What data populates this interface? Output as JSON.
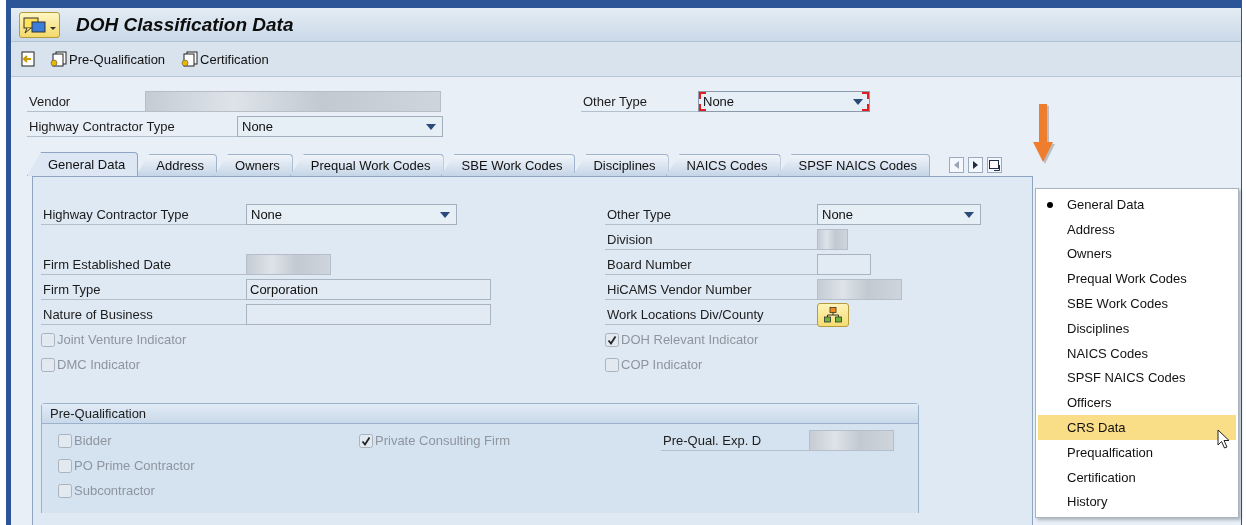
{
  "window": {
    "title": "DOH Classification Data"
  },
  "toolbar": {
    "buttons": [
      {
        "label": "Pre-Qualification"
      },
      {
        "label": "Certification"
      }
    ]
  },
  "header": {
    "left": [
      {
        "kind": "masked",
        "label": "Vendor"
      },
      {
        "kind": "dropdown",
        "label": "Highway Contractor Type",
        "value": "None"
      }
    ],
    "right": [
      {
        "kind": "dropdown",
        "label": "Other Type",
        "value": "None",
        "focused": true
      }
    ]
  },
  "tabs": [
    {
      "label": "General Data",
      "selected": true
    },
    {
      "label": "Address",
      "selected": false
    },
    {
      "label": "Owners",
      "selected": false
    },
    {
      "label": "Prequal Work Codes",
      "selected": false
    },
    {
      "label": "SBE Work Codes",
      "selected": false
    },
    {
      "label": "Disciplines",
      "selected": false
    },
    {
      "label": "NAICS Codes",
      "selected": false
    },
    {
      "label": "SPSF NAICS Codes",
      "selected": false
    }
  ],
  "general_data": {
    "left": [
      {
        "kind": "dropdown",
        "label": "Highway Contractor Type",
        "value": "None"
      },
      {
        "kind": "masked",
        "label": "Firm Established Date"
      },
      {
        "kind": "input",
        "label": "Firm Type",
        "value": "Corporation"
      },
      {
        "kind": "input",
        "label": "Nature of Business"
      },
      {
        "kind": "checkbox",
        "label": "Joint Venture Indicator",
        "checked": false,
        "disabled": true
      },
      {
        "kind": "checkbox",
        "label": "DMC Indicator",
        "checked": false,
        "disabled": true
      }
    ],
    "right": [
      {
        "kind": "dropdown",
        "label": "Other Type",
        "value": "None"
      },
      {
        "kind": "masked",
        "label": "Division"
      },
      {
        "kind": "input",
        "label": "Board Number"
      },
      {
        "kind": "masked",
        "label": "HiCAMS Vendor Number"
      },
      {
        "kind": "button",
        "label": "Work Locations Div/County"
      },
      {
        "kind": "checkbox",
        "label": "DOH Relevant Indicator",
        "checked": true,
        "disabled": true
      },
      {
        "kind": "checkbox",
        "label": "COP Indicator",
        "checked": false,
        "disabled": true
      }
    ]
  },
  "prequalification": {
    "title": "Pre-Qualification",
    "columns": [
      [
        {
          "kind": "checkbox",
          "label": "Bidder",
          "checked": false,
          "disabled": true
        },
        {
          "kind": "checkbox",
          "label": "PO Prime Contractor",
          "checked": false,
          "disabled": true
        },
        {
          "kind": "checkbox",
          "label": "Subcontractor",
          "checked": false,
          "disabled": true
        }
      ],
      [
        {
          "kind": "checkbox",
          "label": "Private Consulting Firm",
          "checked": true,
          "disabled": true
        }
      ],
      [
        {
          "kind": "masked",
          "label": "Pre-Qual. Exp. D"
        }
      ]
    ]
  },
  "tab_menu": {
    "items": [
      {
        "label": "General Data",
        "current": true,
        "selected": false
      },
      {
        "label": "Address",
        "current": false,
        "selected": false
      },
      {
        "label": "Owners",
        "current": false,
        "selected": false
      },
      {
        "label": "Prequal Work Codes",
        "current": false,
        "selected": false
      },
      {
        "label": "SBE Work Codes",
        "current": false,
        "selected": false
      },
      {
        "label": "Disciplines",
        "current": false,
        "selected": false
      },
      {
        "label": "NAICS Codes",
        "current": false,
        "selected": false
      },
      {
        "label": "SPSF NAICS Codes",
        "current": false,
        "selected": false
      },
      {
        "label": "Officers",
        "current": false,
        "selected": false
      },
      {
        "label": "CRS Data",
        "current": false,
        "selected": true
      },
      {
        "label": "Prequalfication",
        "current": false,
        "selected": false
      },
      {
        "label": "Certification",
        "current": false,
        "selected": false
      },
      {
        "label": "History",
        "current": false,
        "selected": false
      }
    ]
  }
}
